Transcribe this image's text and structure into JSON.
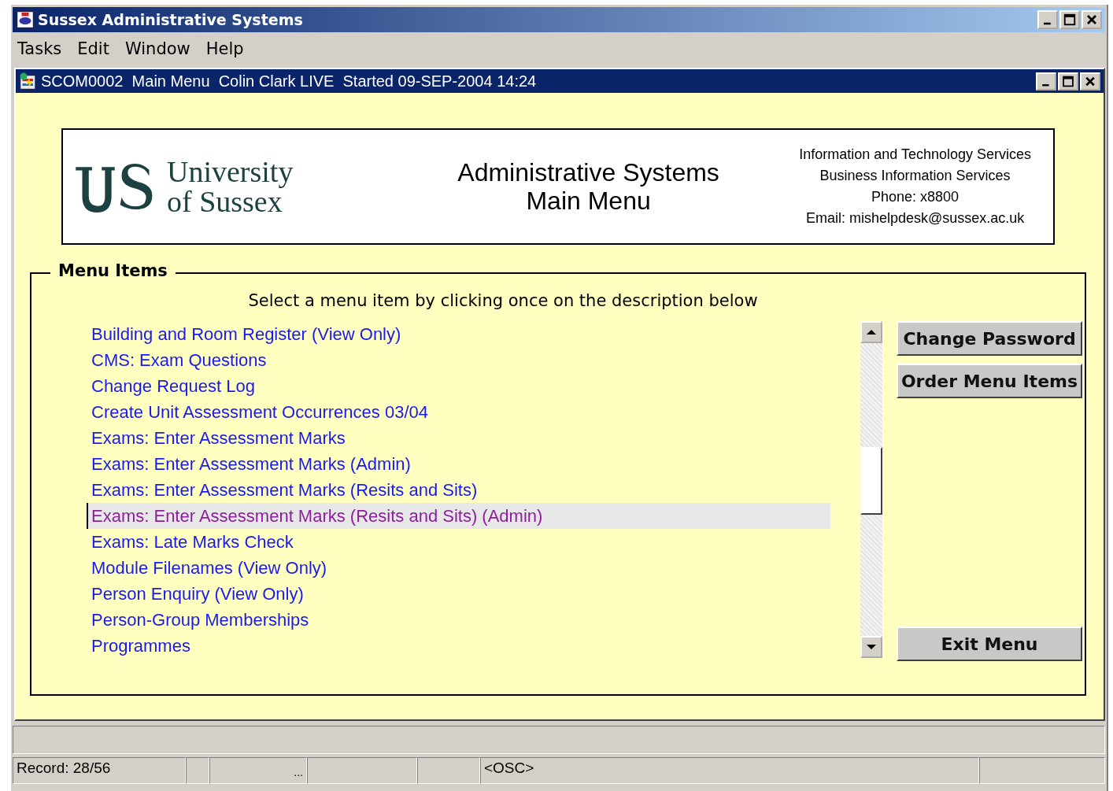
{
  "window": {
    "title": "Sussex Administrative Systems"
  },
  "menu_bar": [
    "Tasks",
    "Edit",
    "Window",
    "Help"
  ],
  "form_window": {
    "title": "SCOM0002  Main Menu  Colin Clark LIVE  Started 09-SEP-2004 14:24"
  },
  "header": {
    "logo_text": [
      "University",
      "of Sussex"
    ],
    "title": [
      "Administrative Systems",
      "Main Menu"
    ],
    "contact": [
      "Information and Technology Services",
      "Business Information Services",
      "Phone: x8800",
      "Email: mishelpdesk@sussex.ac.uk"
    ]
  },
  "menu_items": {
    "legend": "Menu Items",
    "instruction": "Select a menu item by clicking once on the description below",
    "items": [
      {
        "label": "Building and Room Register (View Only)",
        "selected": false
      },
      {
        "label": "CMS: Exam Questions",
        "selected": false
      },
      {
        "label": "Change Request Log",
        "selected": false
      },
      {
        "label": "Create Unit Assessment Occurrences 03/04",
        "selected": false
      },
      {
        "label": "Exams: Enter Assessment Marks",
        "selected": false
      },
      {
        "label": "Exams: Enter Assessment Marks (Admin)",
        "selected": false
      },
      {
        "label": "Exams: Enter Assessment Marks (Resits and Sits)",
        "selected": false
      },
      {
        "label": "Exams: Enter Assessment Marks (Resits and Sits) (Admin)",
        "selected": true
      },
      {
        "label": "Exams: Late Marks Check",
        "selected": false
      },
      {
        "label": "Module Filenames (View Only)",
        "selected": false
      },
      {
        "label": "Person Enquiry (View Only)",
        "selected": false
      },
      {
        "label": "Person-Group Memberships",
        "selected": false
      },
      {
        "label": "Programmes",
        "selected": false
      }
    ]
  },
  "buttons": [
    "Change Password",
    "Order Menu Items"
  ],
  "exit_button": "Exit Menu",
  "status_bar": [
    {
      "kind": "text",
      "text": "Record: 28/56"
    },
    {
      "kind": "empty"
    },
    {
      "kind": "text",
      "text": "..."
    },
    {
      "kind": "empty"
    },
    {
      "kind": "empty"
    },
    {
      "kind": "text",
      "text": "<OSC>"
    },
    {
      "kind": "empty"
    }
  ]
}
